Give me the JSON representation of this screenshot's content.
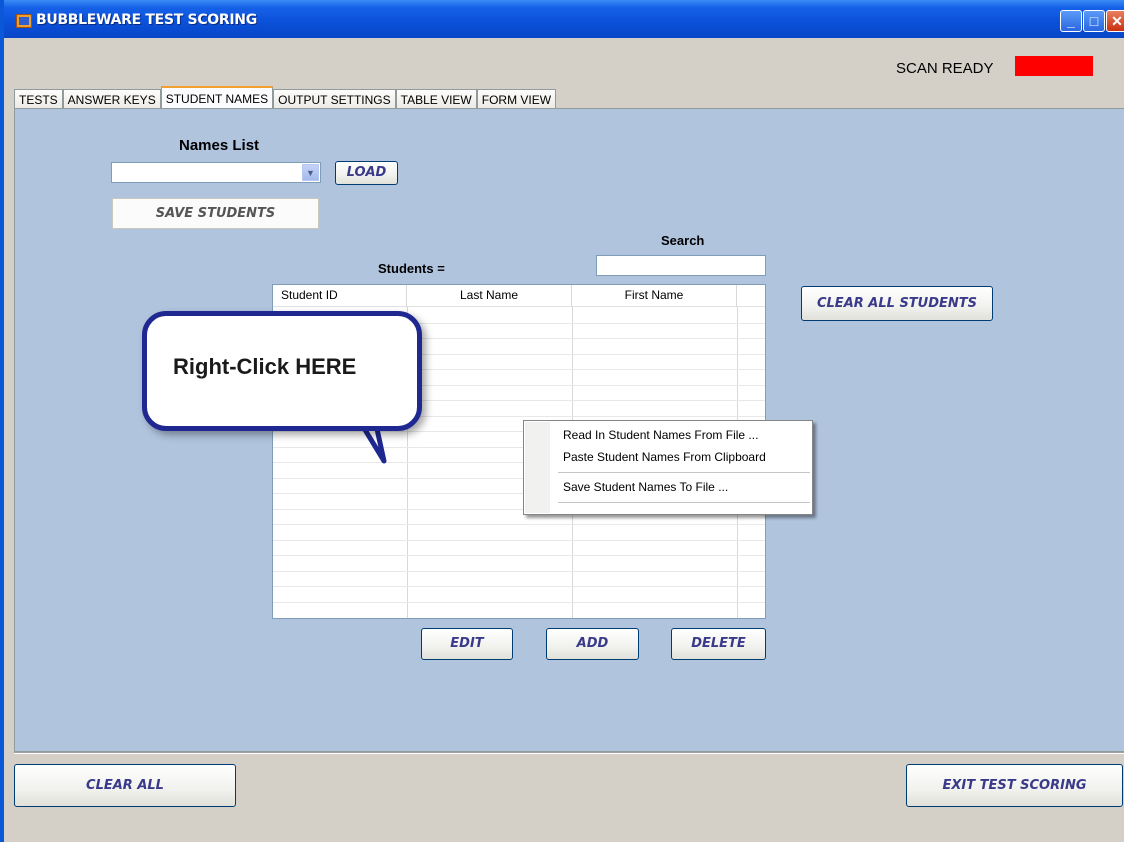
{
  "window": {
    "title": "BUBBLEWARE TEST SCORING"
  },
  "status": {
    "scan_label": "SCAN READY",
    "scan_color": "#ff0000"
  },
  "tabs": [
    {
      "label": "TESTS"
    },
    {
      "label": "ANSWER KEYS"
    },
    {
      "label": "STUDENT NAMES",
      "active": true
    },
    {
      "label": "OUTPUT SETTINGS"
    },
    {
      "label": "TABLE VIEW"
    },
    {
      "label": "FORM VIEW"
    }
  ],
  "names": {
    "title": "Names List",
    "selected": "",
    "load_label": "LOAD",
    "save_label": "SAVE STUDENTS"
  },
  "students": {
    "label": "Students =",
    "count": ""
  },
  "search": {
    "label": "Search",
    "value": ""
  },
  "grid": {
    "columns": [
      "Student ID",
      "Last Name",
      "First Name"
    ],
    "rows": []
  },
  "buttons": {
    "clear_all_students": "CLEAR ALL STUDENTS",
    "edit": "EDIT",
    "add": "ADD",
    "delete": "DELETE",
    "clear_all": "CLEAR ALL",
    "exit": "EXIT TEST SCORING"
  },
  "callout": {
    "text": "Right-Click HERE"
  },
  "context_menu": {
    "items": [
      "Read In Student Names From File ...",
      "Paste Student Names From Clipboard",
      "Save Student Names To File ..."
    ]
  }
}
